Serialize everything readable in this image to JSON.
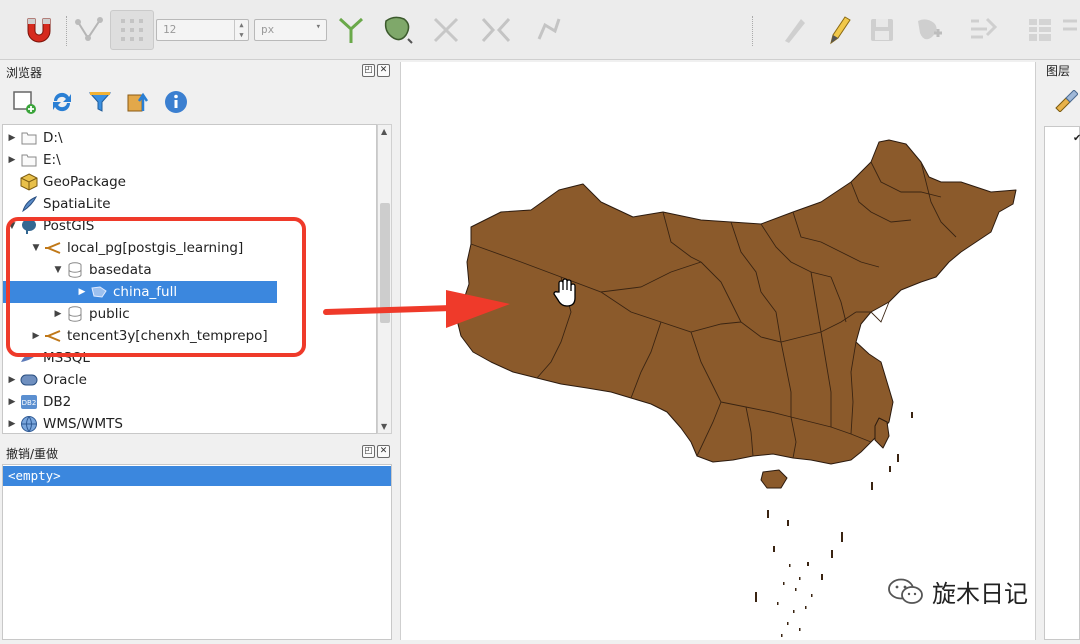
{
  "toolbar": {
    "snap_size_value": "12",
    "snap_unit": "px",
    "icons": [
      "magnet-icon",
      "vertex-tool-icon",
      "snap-type-icon",
      "trace-icon",
      "topology-icon",
      "intersect-icon",
      "edit-vertex-icon",
      "split-icon",
      "pencil-icon",
      "save-edits-icon",
      "add-feature-icon",
      "digitize-icon",
      "undo-edit-icon"
    ]
  },
  "browser_panel": {
    "title": "浏览器",
    "tree": [
      {
        "label": "D:\\",
        "icon": "folder-icon"
      },
      {
        "label": "E:\\",
        "icon": "folder-icon"
      },
      {
        "label": "GeoPackage",
        "icon": "geopackage-icon"
      },
      {
        "label": "SpatiaLite",
        "icon": "spatialite-icon"
      },
      {
        "label": "PostGIS",
        "icon": "postgis-icon"
      },
      {
        "label": "local_pg[postgis_learning]",
        "icon": "connection-icon"
      },
      {
        "label": "basedata",
        "icon": "schema-icon"
      },
      {
        "label": "china_full",
        "icon": "polygon-layer-icon"
      },
      {
        "label": "public",
        "icon": "schema-icon"
      },
      {
        "label": "tencent3y[chenxh_temprepo]",
        "icon": "connection-icon"
      },
      {
        "label": "MSSQL",
        "icon": "mssql-icon"
      },
      {
        "label": "Oracle",
        "icon": "oracle-icon"
      },
      {
        "label": "DB2",
        "icon": "db2-icon"
      },
      {
        "label": "WMS/WMTS",
        "icon": "wms-icon"
      }
    ]
  },
  "undo_panel": {
    "title": "撤销/重做",
    "items": [
      "<empty>"
    ]
  },
  "layers_panel": {
    "title": "图层"
  },
  "map": {
    "fill_color": "#8b5a2b",
    "stroke_color": "#2b1a0e"
  },
  "colors": {
    "selection": "#3b87de",
    "highlight": "#ef3a2a"
  },
  "watermark": {
    "text": "旋木日记"
  }
}
